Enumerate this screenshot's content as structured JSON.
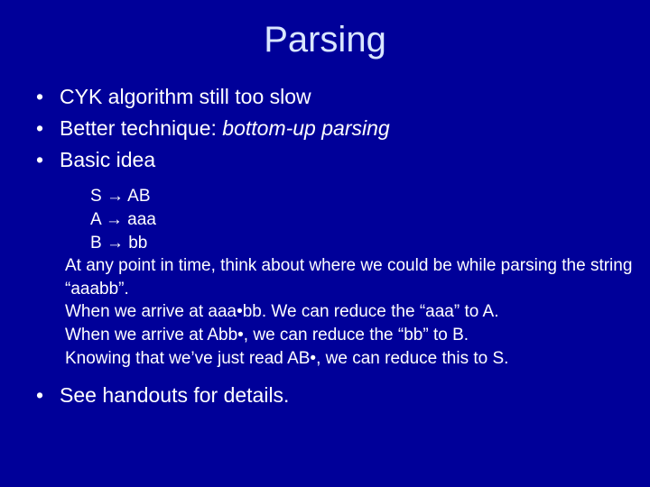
{
  "title": "Parsing",
  "bullets": {
    "b1": "CYK algorithm still too slow",
    "b2a": "Better technique:  ",
    "b2b": "bottom-up parsing",
    "b3": "Basic idea",
    "b4": "See handouts for details."
  },
  "inner": {
    "r1": "S → AB",
    "r2": "A → aaa",
    "r3": "B → bb",
    "l1": "At any point in time, think about where we could be while parsing the string “aaabb”.",
    "l2": "When we arrive at aaa•bb.  We can reduce the “aaa” to A.",
    "l3": "When we arrive at Abb•, we can reduce the “bb” to B.",
    "l4": "Knowing that we’ve just read AB•, we can reduce this to S."
  }
}
